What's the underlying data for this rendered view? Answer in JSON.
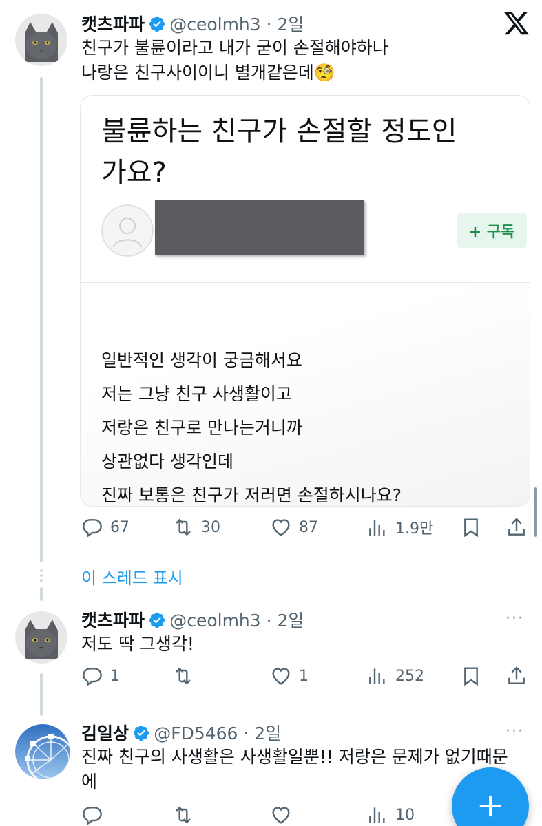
{
  "tweets": [
    {
      "name": "캣츠파파",
      "handle_time": "@ceolmh3 · 2일",
      "text_lines": [
        "친구가 불륜이라고 내가 굳이 손절해야하나",
        "나랑은 친구사이이니 별개같은데🧐"
      ],
      "actions": {
        "replies": "67",
        "retweets": "30",
        "likes": "87",
        "views": "1.9만"
      }
    },
    {
      "name": "캣츠파파",
      "handle_time": "@ceolmh3 · 2일",
      "text_lines": [
        "저도 딱 그생각!"
      ],
      "actions": {
        "replies": "1",
        "retweets": "",
        "likes": "1",
        "views": "252"
      }
    },
    {
      "name": "김일상",
      "handle_time": "@FD5466 · 2일",
      "text_lines": [
        "진짜 친구의 사생활은 사생활일뿐!! 저랑은 문제가 없기때문",
        "에"
      ],
      "actions": {
        "replies": "",
        "retweets": "",
        "likes": "",
        "views": "10"
      }
    }
  ],
  "card": {
    "title_lines": [
      "불륜하는 친구가 손절할 정도인",
      "가요?"
    ],
    "subscribe_label": "+ 구독",
    "body_lines": [
      "일반적인 생각이 궁금해서요",
      "저는 그냥 친구 사생활이고",
      "저랑은 친구로 만나는거니까",
      "상관없다 생각인데",
      "진짜 보통은 친구가 저러면 손절하시나요?"
    ]
  },
  "show_thread_label": "이 스레드 표시",
  "more_label": "···",
  "colors": {
    "accent": "#1d9bf0",
    "text": "#0f1419",
    "secondary": "#536471",
    "thread_line": "#cfd9de",
    "subscribe_green": "#1f8f4e"
  }
}
